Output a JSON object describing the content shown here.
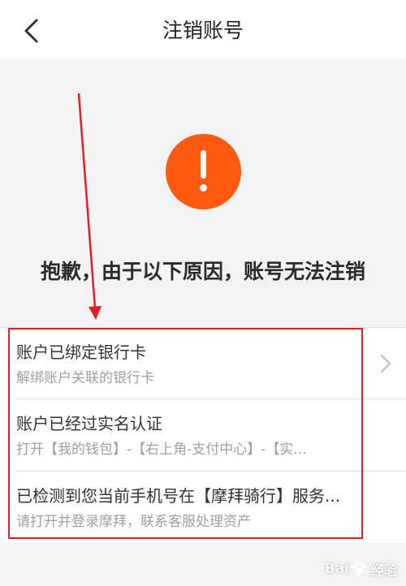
{
  "header": {
    "title": "注销账号"
  },
  "alert": {
    "color": "#ff5a0f",
    "icon": "exclamation-icon"
  },
  "message": "抱歉，由于以下原因，账号无法注销",
  "reasons": [
    {
      "title": "账户已绑定银行卡",
      "subtitle": "解绑账户关联的银行卡"
    },
    {
      "title": "账户已经过实名认证",
      "subtitle": "打开【我的钱包】-【右上角-支付中心】-【实..."
    },
    {
      "title": "已检测到您当前手机号在【摩拜骑行】服务...",
      "subtitle": "请打开并登录摩拜，联系客服处理资产"
    }
  ],
  "watermark": {
    "text": "经验",
    "brand": "Bai"
  },
  "colors": {
    "annotation": "#e21f26"
  }
}
